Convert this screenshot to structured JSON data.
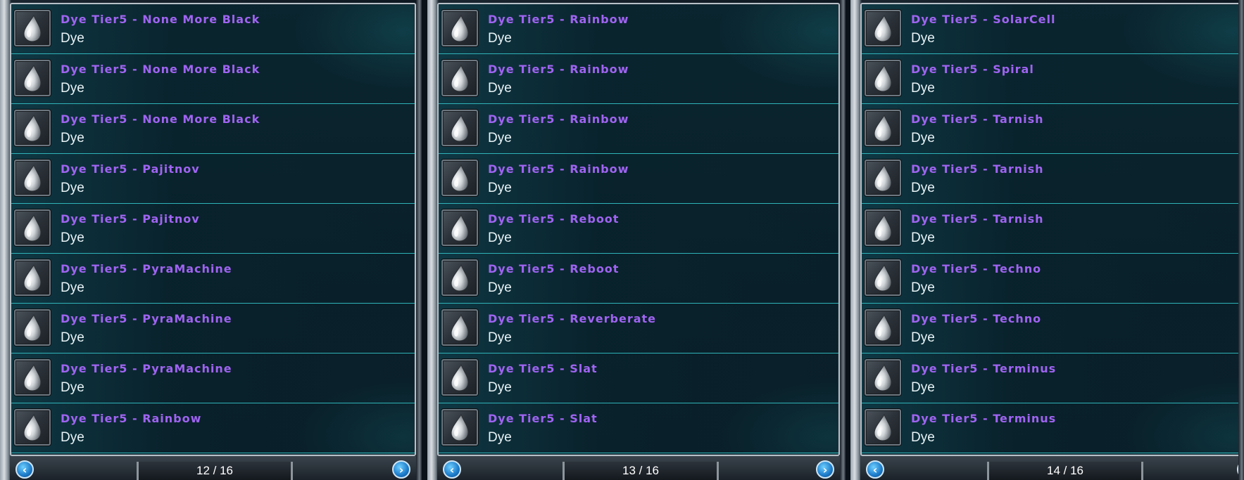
{
  "panels": [
    {
      "items": [
        {
          "name": "Dye Tier5 - None More Black",
          "type": "Dye"
        },
        {
          "name": "Dye Tier5 - None More Black",
          "type": "Dye"
        },
        {
          "name": "Dye Tier5 - None More Black",
          "type": "Dye"
        },
        {
          "name": "Dye Tier5 - Pajitnov",
          "type": "Dye"
        },
        {
          "name": "Dye Tier5 - Pajitnov",
          "type": "Dye"
        },
        {
          "name": "Dye Tier5 - PyraMachine",
          "type": "Dye"
        },
        {
          "name": "Dye Tier5 - PyraMachine",
          "type": "Dye"
        },
        {
          "name": "Dye Tier5 - PyraMachine",
          "type": "Dye"
        },
        {
          "name": "Dye Tier5 - Rainbow",
          "type": "Dye"
        }
      ],
      "page_label": "12 / 16"
    },
    {
      "items": [
        {
          "name": "Dye Tier5 - Rainbow",
          "type": "Dye"
        },
        {
          "name": "Dye Tier5 - Rainbow",
          "type": "Dye"
        },
        {
          "name": "Dye Tier5 - Rainbow",
          "type": "Dye"
        },
        {
          "name": "Dye Tier5 - Rainbow",
          "type": "Dye"
        },
        {
          "name": "Dye Tier5 - Reboot",
          "type": "Dye"
        },
        {
          "name": "Dye Tier5 - Reboot",
          "type": "Dye"
        },
        {
          "name": "Dye Tier5 - Reverberate",
          "type": "Dye"
        },
        {
          "name": "Dye Tier5 - Slat",
          "type": "Dye"
        },
        {
          "name": "Dye Tier5 - Slat",
          "type": "Dye"
        }
      ],
      "page_label": "13 / 16"
    },
    {
      "items": [
        {
          "name": "Dye Tier5 - SolarCell",
          "type": "Dye"
        },
        {
          "name": "Dye Tier5 - Spiral",
          "type": "Dye"
        },
        {
          "name": "Dye Tier5 - Tarnish",
          "type": "Dye"
        },
        {
          "name": "Dye Tier5 - Tarnish",
          "type": "Dye"
        },
        {
          "name": "Dye Tier5 - Tarnish",
          "type": "Dye"
        },
        {
          "name": "Dye Tier5 - Techno",
          "type": "Dye"
        },
        {
          "name": "Dye Tier5 - Techno",
          "type": "Dye"
        },
        {
          "name": "Dye Tier5 - Terminus",
          "type": "Dye"
        },
        {
          "name": "Dye Tier5 - Terminus",
          "type": "Dye"
        }
      ],
      "page_label": "14 / 16"
    }
  ],
  "icons": {
    "item_icon": "dye-drop-icon",
    "prev": "arrow-left-icon",
    "next": "arrow-right-icon"
  },
  "colors": {
    "item_name": "#a064f2",
    "item_type": "#e9f4f7",
    "row_divider": "#2fb3b9",
    "nav_button": "#1b7ac9"
  }
}
